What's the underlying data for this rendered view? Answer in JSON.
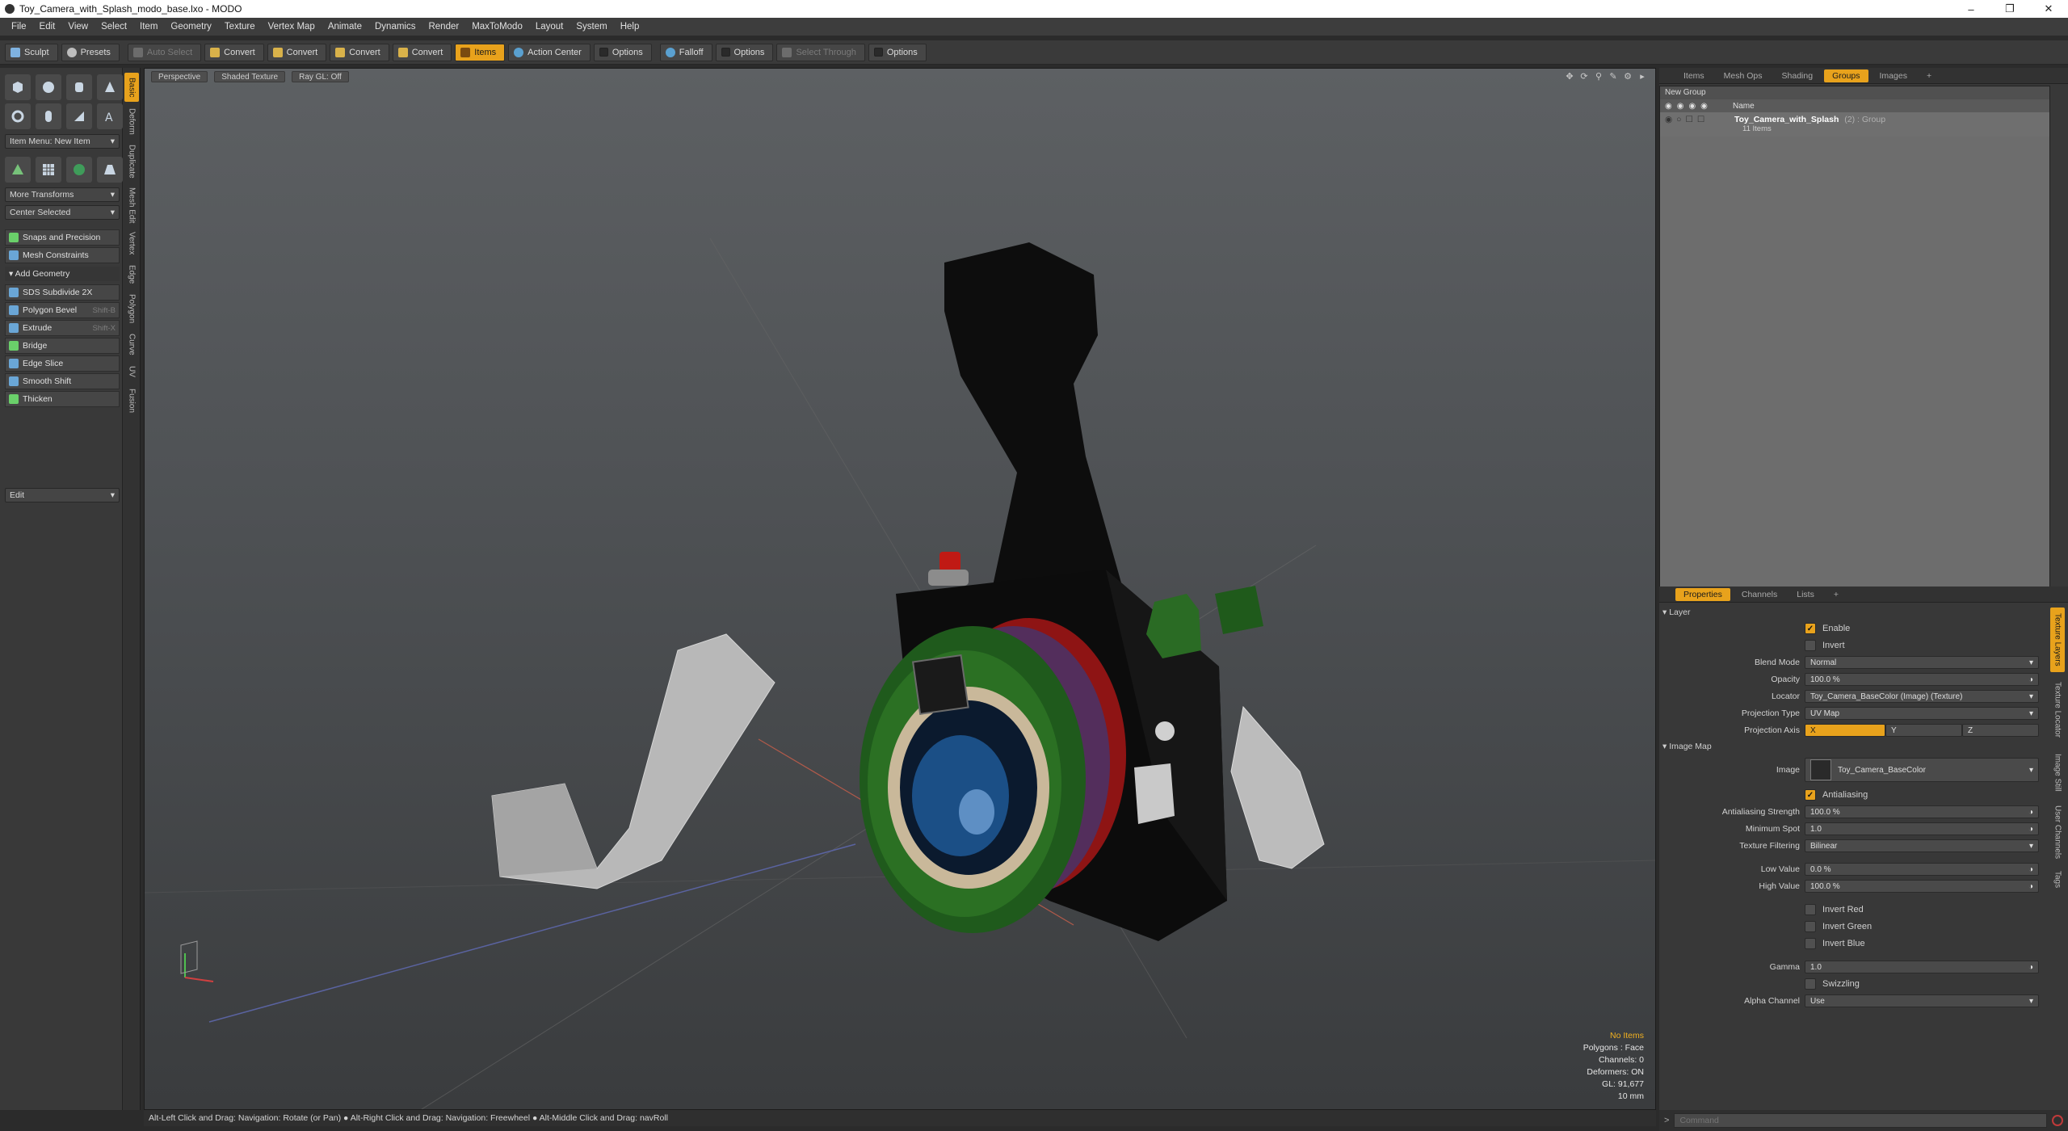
{
  "window": {
    "title": "Toy_Camera_with_Splash_modo_base.lxo - MODO"
  },
  "menu": [
    "File",
    "Edit",
    "View",
    "Select",
    "Item",
    "Geometry",
    "Texture",
    "Vertex Map",
    "Animate",
    "Dynamics",
    "Render",
    "MaxToModo",
    "Layout",
    "System",
    "Help"
  ],
  "toolbar": {
    "sculpt": "Sculpt",
    "presets": "Presets",
    "auto_select": "Auto Select",
    "convert1": "Convert",
    "convert2": "Convert",
    "convert3": "Convert",
    "convert4": "Convert",
    "items": "Items",
    "action_center": "Action Center",
    "options1": "Options",
    "falloff": "Falloff",
    "options2": "Options",
    "select_through": "Select Through",
    "options3": "Options"
  },
  "left": {
    "item_menu": "Item Menu: New Item",
    "more_transforms": "More Transforms",
    "center_selected": "Center Selected",
    "snaps": "Snaps and Precision",
    "mesh_constraints": "Mesh Constraints",
    "add_geometry": "Add Geometry",
    "tools": [
      {
        "label": "SDS Subdivide 2X",
        "shortcut": ""
      },
      {
        "label": "Polygon Bevel",
        "shortcut": "Shift-B"
      },
      {
        "label": "Extrude",
        "shortcut": "Shift-X"
      },
      {
        "label": "Bridge",
        "shortcut": ""
      },
      {
        "label": "Edge Slice",
        "shortcut": ""
      },
      {
        "label": "Smooth Shift",
        "shortcut": ""
      },
      {
        "label": "Thicken",
        "shortcut": ""
      }
    ],
    "edit": "Edit",
    "vtabs": [
      "Basic",
      "Deform",
      "Duplicate",
      "Mesh Edit",
      "Vertex",
      "Edge",
      "Polygon",
      "Curve",
      "UV",
      "Fusion"
    ]
  },
  "viewport": {
    "perspective": "Perspective",
    "shading": "Shaded Texture",
    "raygl": "Ray GL: Off",
    "stats": {
      "no_items": "No Items",
      "polygons": "Polygons : Face",
      "channels": "Channels: 0",
      "deformers": "Deformers: ON",
      "gl": "GL: 91,677",
      "scale": "10 mm"
    }
  },
  "status": "Alt-Left Click and Drag: Navigation: Rotate (or Pan) ● Alt-Right Click and Drag: Navigation: Freewheel ● Alt-Middle Click and Drag: navRoll",
  "groups_panel": {
    "tabs": [
      "Items",
      "Mesh Ops",
      "Shading",
      "Groups",
      "Images"
    ],
    "active_tab": "Groups",
    "new_group": "New Group",
    "col_name": "Name",
    "group_name": "Toy_Camera_with_Splash",
    "group_suffix": "(2) : Group",
    "group_count": "11 Items"
  },
  "properties": {
    "tabs": [
      "Properties",
      "Channels",
      "Lists"
    ],
    "layer": "Layer",
    "enable": "Enable",
    "invert": "Invert",
    "blend_mode_label": "Blend Mode",
    "blend_mode": "Normal",
    "opacity_label": "Opacity",
    "opacity": "100.0 %",
    "locator_label": "Locator",
    "locator": "Toy_Camera_BaseColor (Image) (Texture)",
    "projection_type_label": "Projection Type",
    "projection_type": "UV Map",
    "projection_axis_label": "Projection Axis",
    "axis_x": "X",
    "axis_y": "Y",
    "axis_z": "Z",
    "image_map": "Image Map",
    "image_label": "Image",
    "image": "Toy_Camera_BaseColor",
    "antialiasing": "Antialiasing",
    "aa_strength_label": "Antialiasing Strength",
    "aa_strength": "100.0 %",
    "min_spot_label": "Minimum Spot",
    "min_spot": "1.0",
    "tex_filter_label": "Texture Filtering",
    "tex_filter": "Bilinear",
    "low_label": "Low Value",
    "low": "0.0 %",
    "high_label": "High Value",
    "high": "100.0 %",
    "invert_red": "Invert Red",
    "invert_green": "Invert Green",
    "invert_blue": "Invert Blue",
    "gamma_label": "Gamma",
    "gamma": "1.0",
    "swizzling": "Swizzling",
    "alpha_label": "Alpha Channel",
    "alpha": "Use",
    "side_tabs": [
      "Texture Layers",
      "Texture Locator",
      "Image Still",
      "User Channels",
      "Tags"
    ]
  },
  "command": {
    "placeholder": "Command"
  }
}
